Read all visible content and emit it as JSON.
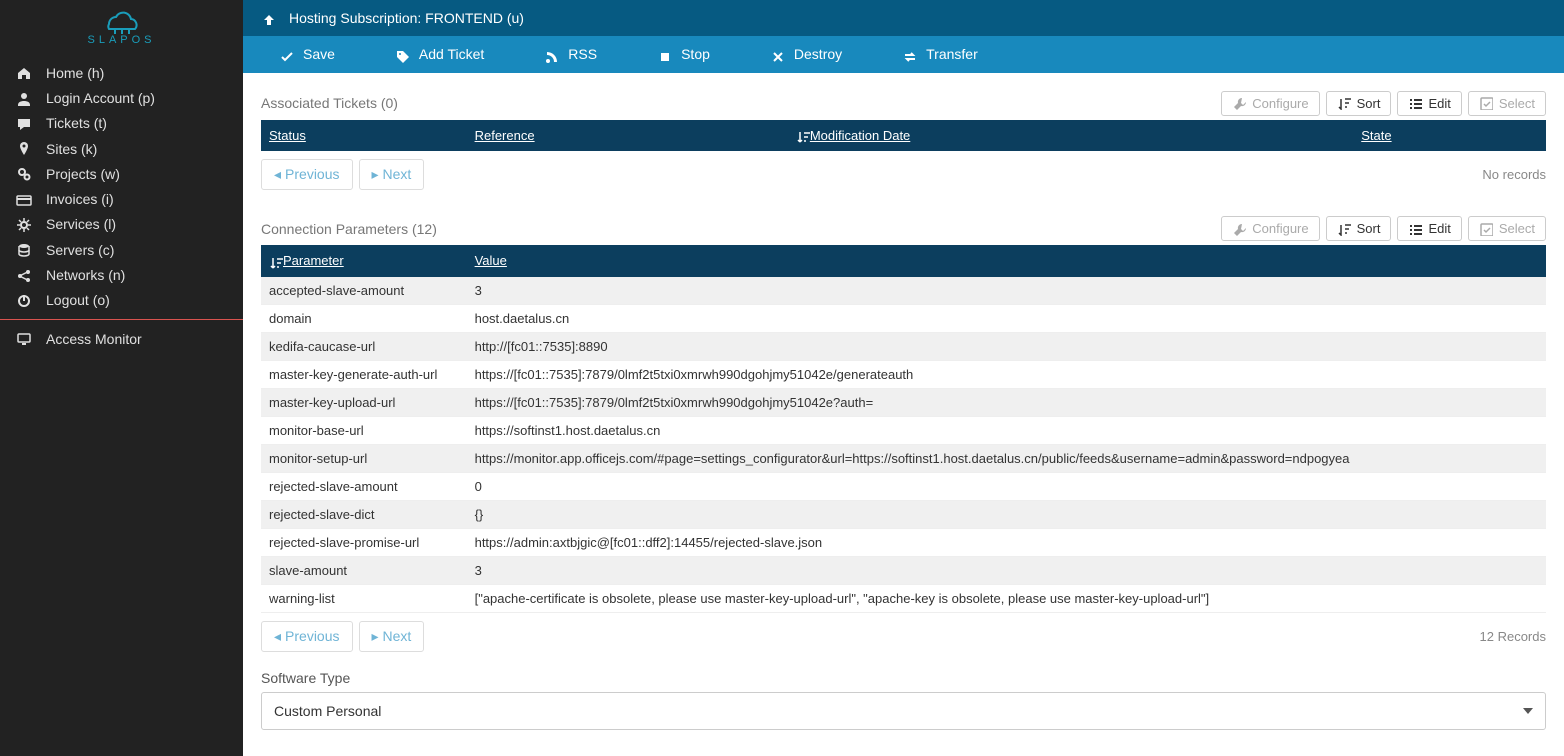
{
  "brand": "SLAPOS",
  "sidebar": {
    "items": [
      {
        "icon": "home",
        "label": "Home (h)"
      },
      {
        "icon": "user",
        "label": "Login Account (p)"
      },
      {
        "icon": "chat",
        "label": "Tickets (t)"
      },
      {
        "icon": "pin",
        "label": "Sites (k)"
      },
      {
        "icon": "gears",
        "label": "Projects (w)"
      },
      {
        "icon": "card",
        "label": "Invoices (i)"
      },
      {
        "icon": "cog",
        "label": "Services (l)"
      },
      {
        "icon": "db",
        "label": "Servers (c)"
      },
      {
        "icon": "share",
        "label": "Networks (n)"
      },
      {
        "icon": "power",
        "label": "Logout (o)"
      }
    ],
    "monitor": {
      "icon": "desktop",
      "label": "Access Monitor"
    }
  },
  "titlebar": {
    "icon": "up",
    "text": "Hosting Subscription: FRONTEND (u)"
  },
  "toolbar": [
    {
      "icon": "check",
      "label": "Save"
    },
    {
      "icon": "tag",
      "label": "Add Ticket"
    },
    {
      "icon": "rss",
      "label": "RSS"
    },
    {
      "icon": "stop",
      "label": "Stop"
    },
    {
      "icon": "x",
      "label": "Destroy"
    },
    {
      "icon": "transfer",
      "label": "Transfer"
    }
  ],
  "tickets": {
    "title": "Associated Tickets (0)",
    "headers": {
      "status": "Status",
      "reference": "Reference",
      "modification": "Modification Date",
      "state": "State"
    },
    "rows": [],
    "pager": {
      "prev": "Previous",
      "next": "Next",
      "info": "No records"
    }
  },
  "params": {
    "title": "Connection Parameters (12)",
    "headers": {
      "param": "Parameter",
      "value": "Value"
    },
    "rows": [
      {
        "param": "accepted-slave-amount",
        "value": "3"
      },
      {
        "param": "domain",
        "value": "host.daetalus.cn"
      },
      {
        "param": "kedifa-caucase-url",
        "value": "http://[fc01::7535]:8890"
      },
      {
        "param": "master-key-generate-auth-url",
        "value": "https://[fc01::7535]:7879/0lmf2t5txi0xmrwh990dgohjmy51042e/generateauth"
      },
      {
        "param": "master-key-upload-url",
        "value": "https://[fc01::7535]:7879/0lmf2t5txi0xmrwh990dgohjmy51042e?auth="
      },
      {
        "param": "monitor-base-url",
        "value": "https://softinst1.host.daetalus.cn"
      },
      {
        "param": "monitor-setup-url",
        "value": "https://monitor.app.officejs.com/#page=settings_configurator&url=https://softinst1.host.daetalus.cn/public/feeds&username=admin&password=ndpogyea"
      },
      {
        "param": "rejected-slave-amount",
        "value": "0"
      },
      {
        "param": "rejected-slave-dict",
        "value": "{}"
      },
      {
        "param": "rejected-slave-promise-url",
        "value": "https://admin:axtbjgic@[fc01::dff2]:14455/rejected-slave.json"
      },
      {
        "param": "slave-amount",
        "value": "3"
      },
      {
        "param": "warning-list",
        "value": "[\"apache-certificate is obsolete, please use master-key-upload-url\", \"apache-key is obsolete, please use master-key-upload-url\"]"
      }
    ],
    "pager": {
      "prev": "Previous",
      "next": "Next",
      "info": "12 Records"
    }
  },
  "buttons": {
    "configure": "Configure",
    "sort": "Sort",
    "edit": "Edit",
    "select": "Select"
  },
  "software_type": {
    "label": "Software Type",
    "value": "Custom Personal"
  }
}
